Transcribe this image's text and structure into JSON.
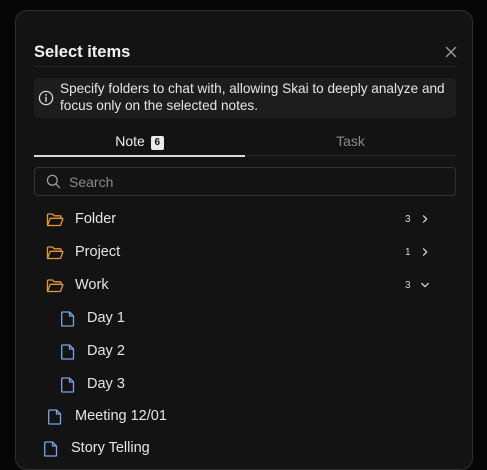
{
  "dialog": {
    "title": "Select items",
    "info_text": "Specify folders to chat with, allowing Skai to deeply analyze and focus only on the selected notes."
  },
  "tabs": [
    {
      "label": "Note",
      "badge": "6",
      "active": true
    },
    {
      "label": "Task",
      "active": false
    }
  ],
  "search": {
    "placeholder": "Search",
    "value": ""
  },
  "tree": [
    {
      "type": "folder",
      "label": "Folder",
      "count": "3",
      "expanded": false
    },
    {
      "type": "folder",
      "label": "Project",
      "count": "1",
      "expanded": false
    },
    {
      "type": "folder",
      "label": "Work",
      "count": "3",
      "expanded": true
    },
    {
      "type": "file",
      "label": "Day 1",
      "depth": 1
    },
    {
      "type": "file",
      "label": "Day 2",
      "depth": 1
    },
    {
      "type": "file",
      "label": "Day 3",
      "depth": 1
    },
    {
      "type": "file",
      "label": "Meeting 12/01",
      "depth": 0
    },
    {
      "type": "file",
      "label": "Story Telling",
      "depth": 0
    }
  ],
  "colors": {
    "folder_icon": "#e8973a",
    "file_icon": "#7da3e0",
    "accent": "#d8d8d8"
  },
  "icons": {
    "close": "close-icon",
    "info": "info-icon",
    "search": "search-icon",
    "folder": "folder-open-icon",
    "file": "file-icon",
    "collapsed": "chevron-right-icon",
    "expanded": "chevron-down-icon"
  }
}
